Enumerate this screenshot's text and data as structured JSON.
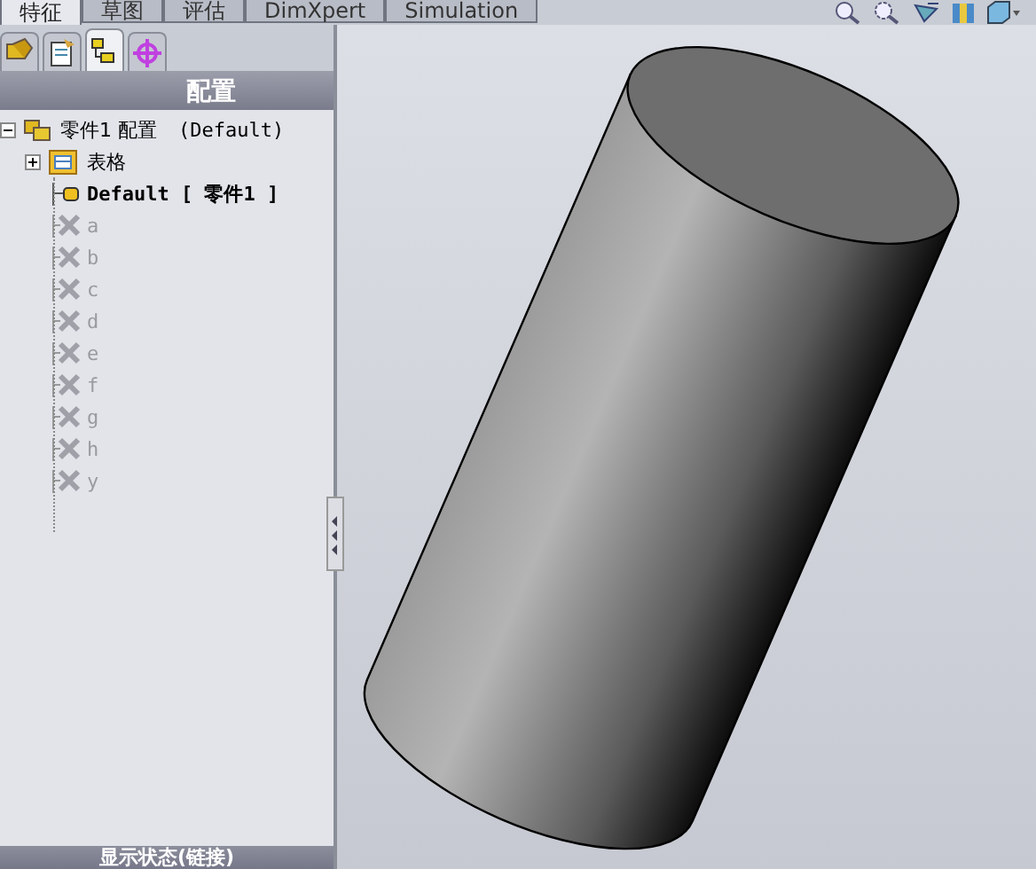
{
  "tabs": [
    {
      "label": "特征",
      "selected": true
    },
    {
      "label": "草图",
      "selected": false
    },
    {
      "label": "评估",
      "selected": false
    },
    {
      "label": "DimXpert",
      "selected": false
    },
    {
      "label": "Simulation",
      "selected": false
    }
  ],
  "panel_tabs": [
    {
      "kind": "feature",
      "selected": false
    },
    {
      "kind": "property",
      "selected": false
    },
    {
      "kind": "config",
      "selected": true
    },
    {
      "kind": "dim",
      "selected": false
    }
  ],
  "panel": {
    "title": "配置",
    "footer": "显示状态(链接)"
  },
  "tree": {
    "label": "零件1 配置",
    "note": "(Default)",
    "expanded": true,
    "children": [
      {
        "kind": "folder",
        "label": "表格",
        "expanded": false
      },
      {
        "kind": "config",
        "label": "Default [ 零件1 ]",
        "active": true
      },
      {
        "kind": "config",
        "label": "a",
        "active": false
      },
      {
        "kind": "config",
        "label": "b",
        "active": false
      },
      {
        "kind": "config",
        "label": "c",
        "active": false
      },
      {
        "kind": "config",
        "label": "d",
        "active": false
      },
      {
        "kind": "config",
        "label": "e",
        "active": false
      },
      {
        "kind": "config",
        "label": "f",
        "active": false
      },
      {
        "kind": "config",
        "label": "g",
        "active": false
      },
      {
        "kind": "config",
        "label": "h",
        "active": false
      },
      {
        "kind": "config",
        "label": "y",
        "active": false
      }
    ]
  }
}
